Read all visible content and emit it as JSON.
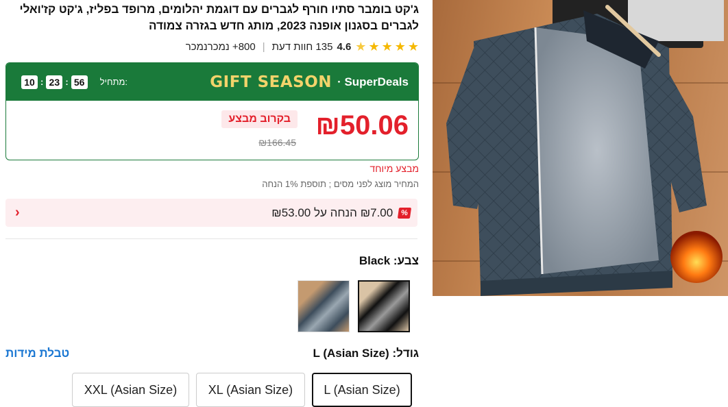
{
  "product": {
    "title": "ג'קט בומבר סתיו חורף לגברים עם דוגמת יהלומים, מרופד בפליז, ג'קט קז'ואלי לגברים בסגנון אופנה 2023, מותג חדש בגזרה צמודה",
    "rating": "4.6",
    "reviews": "135 חוות דעת",
    "sold": "800+ נמכרנמכר",
    "stars_count": 5
  },
  "deal": {
    "brand_gift": "GIFT SEASON",
    "brand_super": "· SuperDeals",
    "starts_label": "מתחיל:",
    "timer": [
      "10",
      "23",
      "56"
    ],
    "price": "₪50.06",
    "old_price": "₪166.45",
    "coming_soon": "בקרוב מבצע"
  },
  "special_offer": "מבצע מיוחד",
  "tax_note": "המחיר מוצג לפני מסים ; תוספת 1% הנחה",
  "coupon": {
    "icon_text": "%",
    "text": "₪7.00 הנחה על ₪53.00"
  },
  "color": {
    "label": "צבע:",
    "value": "Black"
  },
  "size": {
    "label": "גודל:",
    "value": "L (Asian Size)",
    "chart_link": "טבלת מידות",
    "options": [
      "L (Asian Size)",
      "XL (Asian Size)",
      "XXL (Asian Size)"
    ]
  },
  "colors": {
    "accent_red": "#e3202b",
    "deal_green": "#1a7a3a",
    "gift_gold": "#f2d36b",
    "link_blue": "#1976d2"
  }
}
